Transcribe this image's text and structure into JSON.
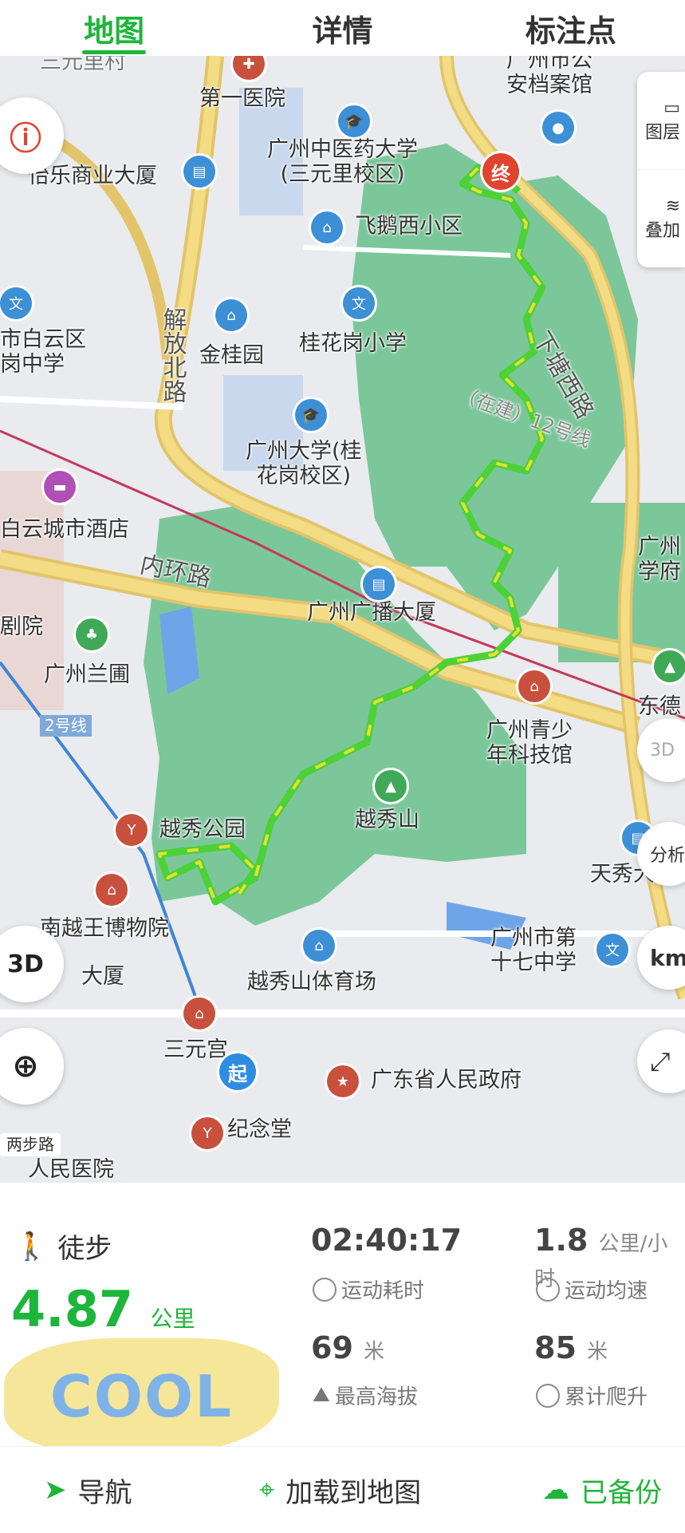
{
  "tabs": [
    {
      "label": "地图",
      "active": true
    },
    {
      "label": "详情",
      "active": false
    },
    {
      "label": "标注点",
      "active": false
    }
  ],
  "map": {
    "labels": {
      "first_hospital": "第一医院",
      "archive": "广州市公\n安档案馆",
      "tcm_univ": "广州中医药大学\n(三元里校区)",
      "yile": "怡乐商业大厦",
      "feipeng": "飞鹅西小区",
      "baiyun_school": "市白云区\n岗中学",
      "jingui": "金桂园",
      "guihua_school": "桂花岗小学",
      "gz_univ": "广州大学(桂\n花岗校区)",
      "hotel": "白云城市酒店",
      "inner_ring": "内环路",
      "broadcast": "广州广播大厦",
      "orchid": "广州兰圃",
      "youth_museum": "广州青少\n年科技馆",
      "yuexiu_hill": "越秀山",
      "yuexiu_park": "越秀公园",
      "nanyue": "南越王博物院",
      "dasha": "大厦",
      "stadium": "越秀山体育场",
      "school17": "广州市第\n十七中学",
      "sanyuan": "三元宫",
      "gov": "广东省人民政府",
      "memorial": "纪念堂",
      "tianxiu": "天秀大",
      "dongde": "东德",
      "people_hosp": "人民医院",
      "theater": "剧院",
      "xiatang": "下塘西路",
      "jiefang": "解放北路",
      "line12": "（在建）12号线",
      "line2": "2号线",
      "guangzhou_right": "广州\n学府",
      "sanyuan_top": "三元里村",
      "walk_road": "两步路"
    },
    "panel": {
      "layers": "图层",
      "overlay": "叠加"
    },
    "buttons": {
      "btn_3d": "3D",
      "analysis": "分析",
      "km": "km"
    },
    "markers": {
      "start": "起",
      "end": "终"
    }
  },
  "activity": {
    "type": "徒步",
    "distance": "4.87",
    "distance_unit": "公里",
    "duration": "02:40:17",
    "duration_label": "运动耗时",
    "speed": "1.8",
    "speed_unit": "公里/小时",
    "speed_label": "运动均速",
    "max_alt": "69",
    "max_alt_unit": "米",
    "max_alt_label": "最高海拔",
    "climb": "85",
    "climb_unit": "米",
    "climb_label": "累计爬升",
    "sticker": "COOL"
  },
  "actions": {
    "navigate": "导航",
    "load_map": "加载到地图",
    "backed_up": "已备份"
  },
  "colors": {
    "accent": "#1db53a",
    "route_green": "#4cd137",
    "route_yellow": "#e6e033"
  }
}
